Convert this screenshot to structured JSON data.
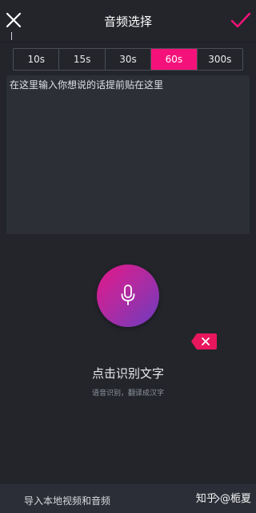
{
  "header": {
    "title": "音频选择",
    "close_icon": "close-icon",
    "confirm_icon": "check-icon"
  },
  "durations": {
    "options": [
      "10s",
      "15s",
      "30s",
      "60s",
      "300s"
    ],
    "selected": "60s"
  },
  "text_input": {
    "placeholder": "在这里输入你想说的话提前贴在这里"
  },
  "record": {
    "icon": "microphone-icon",
    "label": "点击识别文字",
    "hint": "语音识别，翻译成汉字"
  },
  "delete": {
    "icon": "backspace-icon"
  },
  "footer": {
    "import_label": "导入本地视频和音频",
    "watermark": "知乎 @栀夏"
  },
  "colors": {
    "background": "#23252b",
    "accent": "#f4127a",
    "panel": "#2c2f36"
  }
}
